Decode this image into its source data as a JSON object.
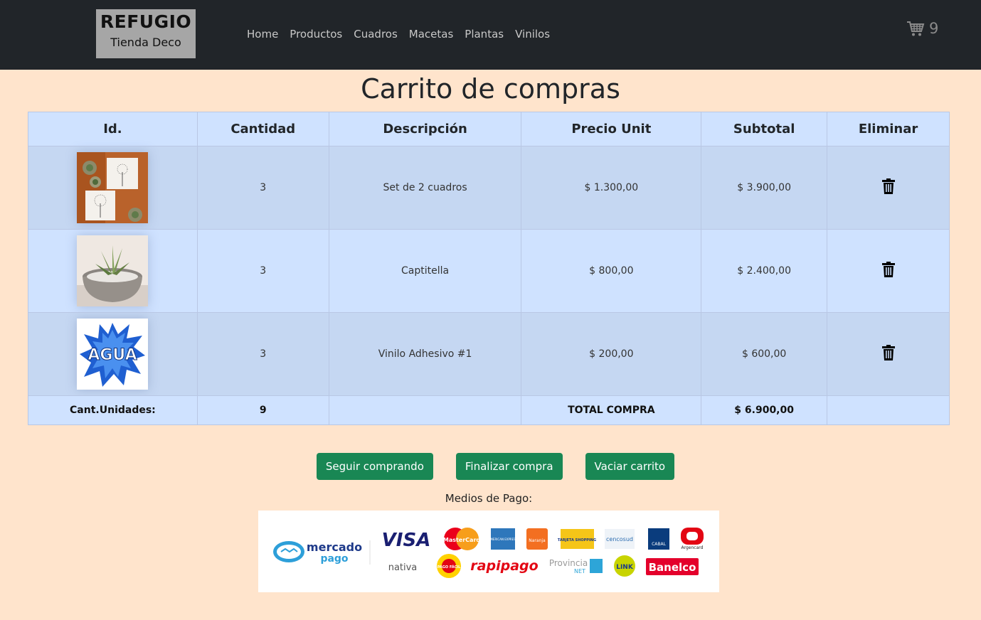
{
  "navbar": {
    "brand_title": "REFUGIO",
    "brand_subtitle": "Tienda Deco",
    "links": [
      "Home",
      "Productos",
      "Cuadros",
      "Macetas",
      "Plantas",
      "Vinilos"
    ],
    "cart_count": "9",
    "cart_icon": "cart-icon"
  },
  "page": {
    "title": "Carrito de compras"
  },
  "table": {
    "headers": [
      "Id.",
      "Cantidad",
      "Descripción",
      "Precio Unit",
      "Subtotal",
      "Eliminar"
    ],
    "rows": [
      {
        "image": "cuadros-image",
        "qty": "3",
        "desc": "Set de 2 cuadros",
        "price": "$ 1.300,00",
        "subtotal": "$ 3.900,00"
      },
      {
        "image": "planta-image",
        "qty": "3",
        "desc": "Captitella",
        "price": "$ 800,00",
        "subtotal": "$ 2.400,00"
      },
      {
        "image": "vinilo-image",
        "qty": "3",
        "desc": "Vinilo Adhesivo #1",
        "price": "$ 200,00",
        "subtotal": "$ 600,00"
      }
    ],
    "footer": {
      "units_label": "Cant.Unidades:",
      "units_value": "9",
      "total_label": "TOTAL COMPRA",
      "total_value": "$ 6.900,00"
    }
  },
  "vinilo_text": "AGUA",
  "actions": {
    "continue": "Seguir comprando",
    "checkout": "Finalizar compra",
    "empty": "Vaciar carrito"
  },
  "payments": {
    "label": "Medios de Pago:",
    "mp_line1": "mercado",
    "mp_line2": "pago",
    "cards": [
      "VISA",
      "MasterCard",
      "AMERICAN EXPRESS",
      "Naranja",
      "TARJETA SHOPPING",
      "cencosud",
      "CABAL",
      "Argencard"
    ],
    "row2": [
      "nativa",
      "PAGO FÁCIL",
      "rapipago",
      "Provincia",
      "NET",
      "LINK",
      "Banelco"
    ]
  },
  "colors": {
    "accent": "#198754",
    "navbar": "#212529",
    "background": "#ffe4cc",
    "table": "#cfe2ff"
  }
}
